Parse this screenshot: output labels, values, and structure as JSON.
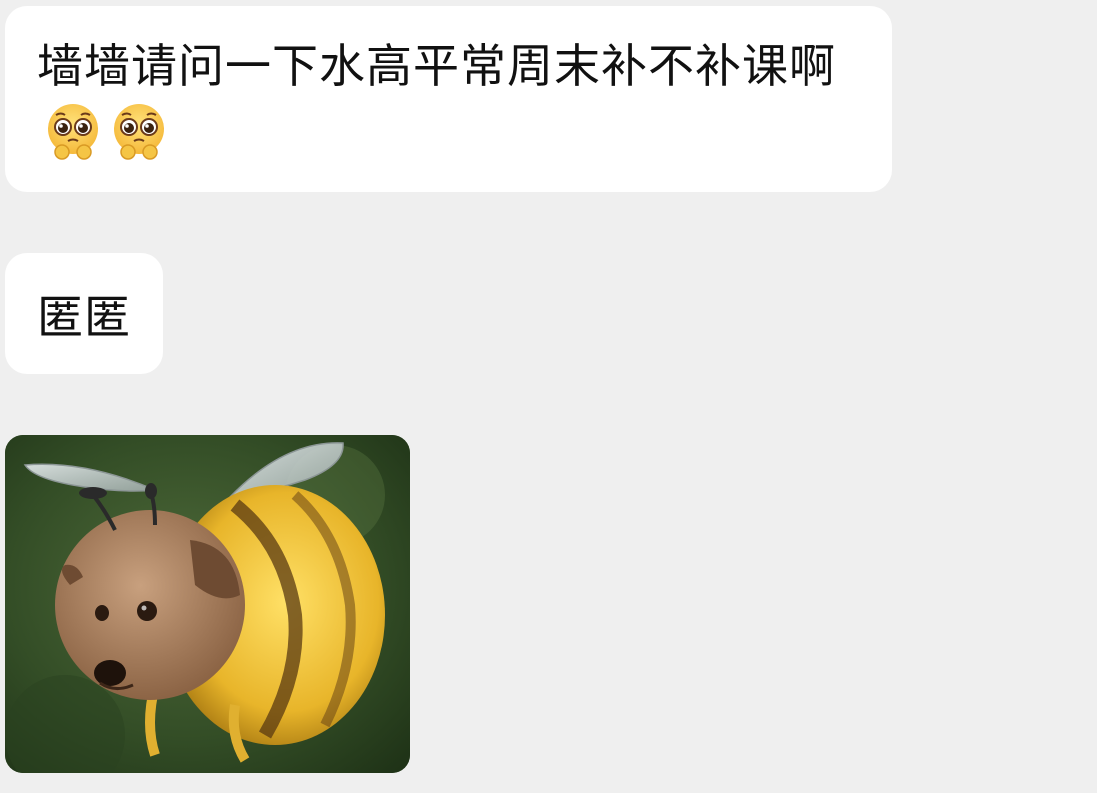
{
  "messages": [
    {
      "type": "text",
      "text": "墙墙请问一下水高平常周末补不补课啊",
      "emojis": [
        "pleading-face",
        "pleading-face"
      ]
    },
    {
      "type": "text",
      "text": "匿匿"
    },
    {
      "type": "image",
      "image_subject": "dog-bee-sticker"
    }
  ],
  "colors": {
    "background": "#efefef",
    "bubble": "#ffffff",
    "text": "#111111"
  }
}
